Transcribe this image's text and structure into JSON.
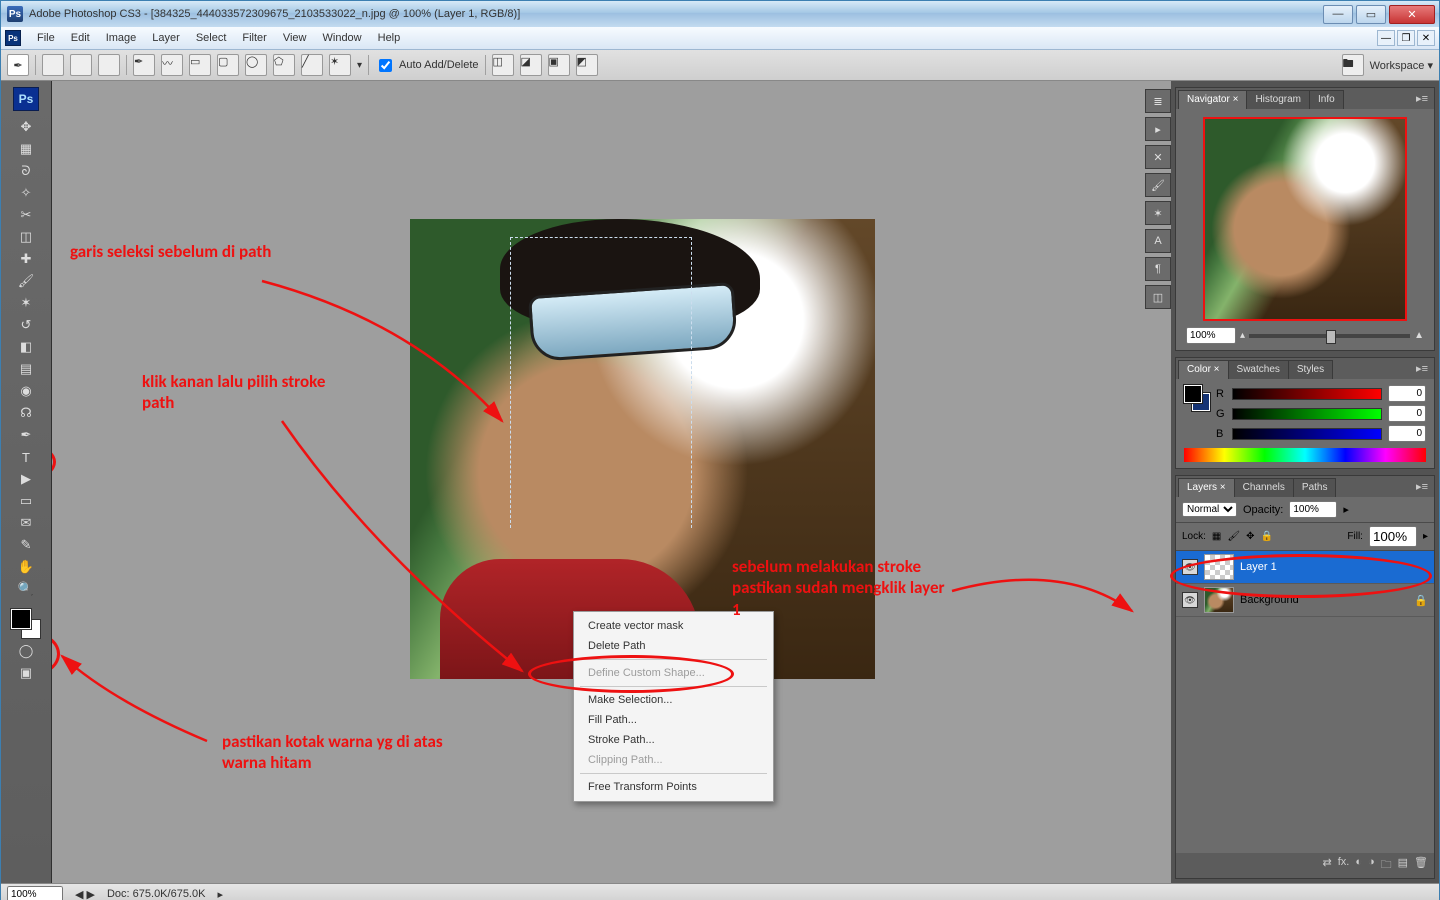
{
  "title": "Adobe Photoshop CS3 - [384325_444033572309675_2103533022_n.jpg @ 100% (Layer 1, RGB/8)]",
  "app_short": "Ps",
  "menu": [
    "File",
    "Edit",
    "Image",
    "Layer",
    "Select",
    "Filter",
    "View",
    "Window",
    "Help"
  ],
  "options": {
    "auto_add_delete": "Auto Add/Delete",
    "workspace": "Workspace"
  },
  "context_menu": {
    "create_vector_mask": "Create vector mask",
    "delete_path": "Delete Path",
    "define_custom_shape": "Define Custom Shape...",
    "make_selection": "Make Selection...",
    "fill_path": "Fill Path...",
    "stroke_path": "Stroke Path...",
    "clipping_path": "Clipping Path...",
    "free_transform": "Free Transform Points"
  },
  "annotations": {
    "a1": "garis seleksi sebelum di path",
    "a2": "klik kanan lalu pilih stroke path",
    "a3": "sebelum melakukan stroke pastikan sudah mengklik layer 1",
    "a4": "pastikan kotak warna yg di atas warna hitam"
  },
  "navigator": {
    "tabs": [
      "Navigator",
      "Histogram",
      "Info"
    ],
    "zoom": "100%"
  },
  "color": {
    "tabs": [
      "Color",
      "Swatches",
      "Styles"
    ],
    "r": "0",
    "g": "0",
    "b": "0"
  },
  "layers": {
    "tabs": [
      "Layers",
      "Channels",
      "Paths"
    ],
    "blend": "Normal",
    "opacity_label": "Opacity:",
    "opacity": "100%",
    "lock_label": "Lock:",
    "fill_label": "Fill:",
    "fill": "100%",
    "layer1": "Layer 1",
    "background": "Background"
  },
  "status": {
    "zoom": "100%",
    "doc": "Doc: 675.0K/675.0K"
  },
  "colors": {
    "annotation": "#e11111",
    "selection": "#1a6bd2"
  }
}
